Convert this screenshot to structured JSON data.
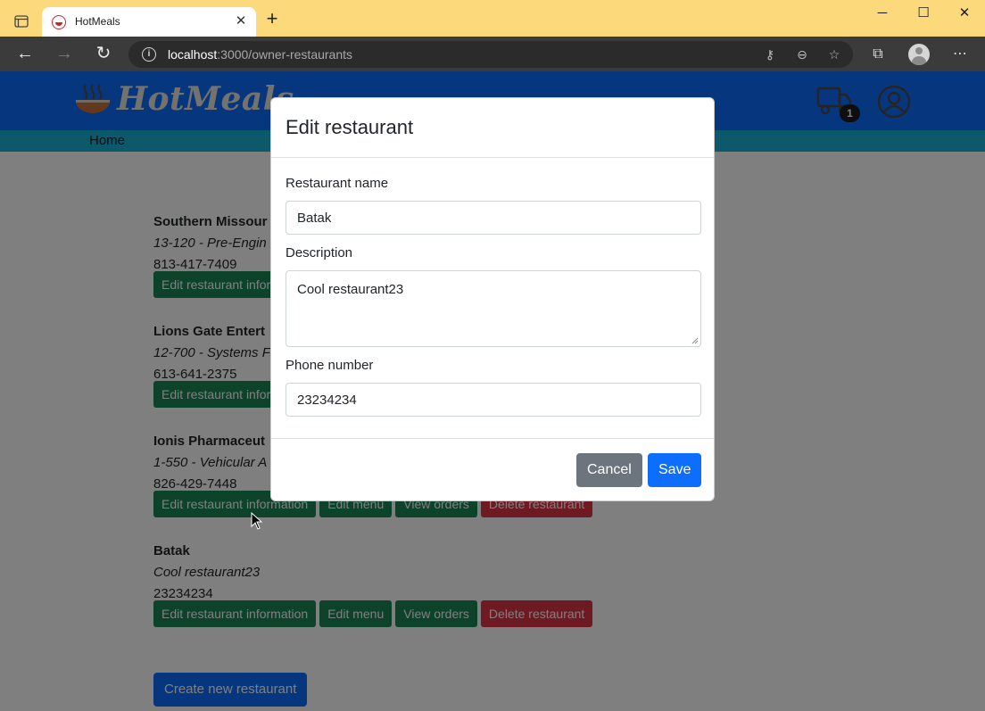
{
  "browser": {
    "tab_title": "HotMeals",
    "url_host": "localhost",
    "url_rest": ":3000/owner-restaurants",
    "window_controls": [
      "minimize-icon",
      "maximize-icon",
      "close-icon"
    ]
  },
  "header": {
    "logo_text": "HotMeals",
    "cart_count": "1",
    "nav_home": "Home"
  },
  "restaurants": [
    {
      "name": "Southern Missour",
      "description": "13-120 - Pre-Engin",
      "phone": "813-417-7409",
      "actions": [
        "Edit restaurant infor"
      ]
    },
    {
      "name": "Lions Gate Entert",
      "description": "12-700 - Systems F",
      "phone": "613-641-2375",
      "actions": [
        "Edit restaurant infor"
      ]
    },
    {
      "name": "Ionis Pharmaceut",
      "description": "1-550 - Vehicular A",
      "phone": "826-429-7448",
      "actions": [
        "Edit restaurant information",
        "Edit menu",
        "View orders",
        "Delete restaurant"
      ]
    },
    {
      "name": "Batak",
      "description": "Cool restaurant23",
      "phone": "23234234",
      "actions": [
        "Edit restaurant information",
        "Edit menu",
        "View orders",
        "Delete restaurant"
      ]
    }
  ],
  "create_button": "Create new restaurant",
  "modal": {
    "title": "Edit restaurant",
    "name_label": "Restaurant name",
    "name_value": "Batak",
    "description_label": "Description",
    "description_value": "Cool restaurant23",
    "phone_label": "Phone number",
    "phone_value": "23234234",
    "cancel_label": "Cancel",
    "save_label": "Save"
  },
  "colors": {
    "header": "#0d6efd",
    "subnav": "#17b2d4",
    "success": "#198754",
    "danger": "#dc3545",
    "primary": "#0d6efd",
    "secondary": "#6c757d"
  }
}
